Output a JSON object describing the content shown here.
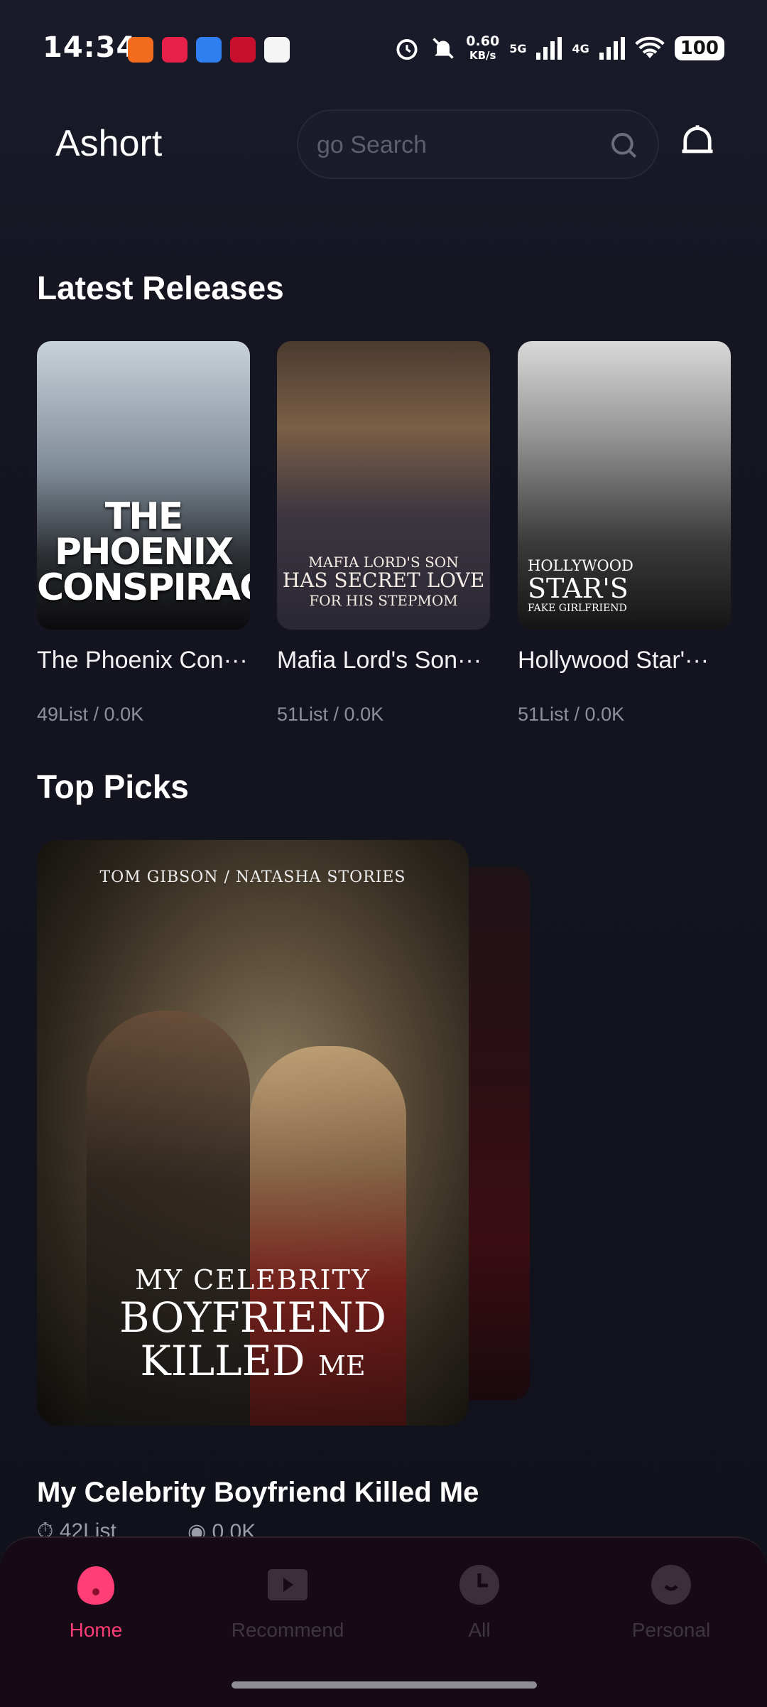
{
  "status_bar": {
    "time": "14:34",
    "net_speed_value": "0.60",
    "net_speed_unit": "KB/s",
    "signal1": "5G",
    "signal2": "4G",
    "battery": "100"
  },
  "header": {
    "app_title": "Ashort",
    "search_placeholder": "go Search"
  },
  "latest": {
    "section_title": "Latest Releases",
    "items": [
      {
        "title": "The Phoenix Conspiracy",
        "display_title": "The Phoenix Con···",
        "meta": "49List / 0.0K",
        "poster_text": "THE PHOENIX CONSPIRACY"
      },
      {
        "title": "Mafia Lord's Son Has Secret Love For His Stepmom",
        "display_title": "Mafia Lord's Son···",
        "meta": "51List / 0.0K",
        "poster_line1": "MAFIA LORD'S SON",
        "poster_line2": "HAS SECRET LOVE",
        "poster_line3": "FOR HIS STEPMOM"
      },
      {
        "title": "Hollywood Star's Fake Girlfriend",
        "display_title": "Hollywood Star'···",
        "meta": "51List / 0.0K",
        "poster_line1": "HOLLYWOOD",
        "poster_line2": "STAR'S",
        "poster_line3": "FAKE     GIRLFRIEND"
      }
    ]
  },
  "top_picks": {
    "section_title": "Top Picks",
    "featured": {
      "credits": "TOM GIBSON   /   NATASHA STORIES",
      "poster_line1": "MY CELEBRITY",
      "poster_line2": "BOYFRIEND",
      "poster_line3": "KILLED",
      "poster_line3_small": "ME",
      "title": "My Celebrity Boyfriend Killed Me",
      "episodes": "42List",
      "views": "0.0K"
    }
  },
  "tabs": [
    {
      "label": "Home",
      "icon": "home-icon",
      "active": true
    },
    {
      "label": "Recommend",
      "icon": "play-icon",
      "active": false
    },
    {
      "label": "All",
      "icon": "clock-icon",
      "active": false
    },
    {
      "label": "Personal",
      "icon": "person-icon",
      "active": false
    }
  ],
  "colors": {
    "accent": "#ff3d76",
    "background": "#12131d",
    "tab_bar": "#150a15"
  }
}
